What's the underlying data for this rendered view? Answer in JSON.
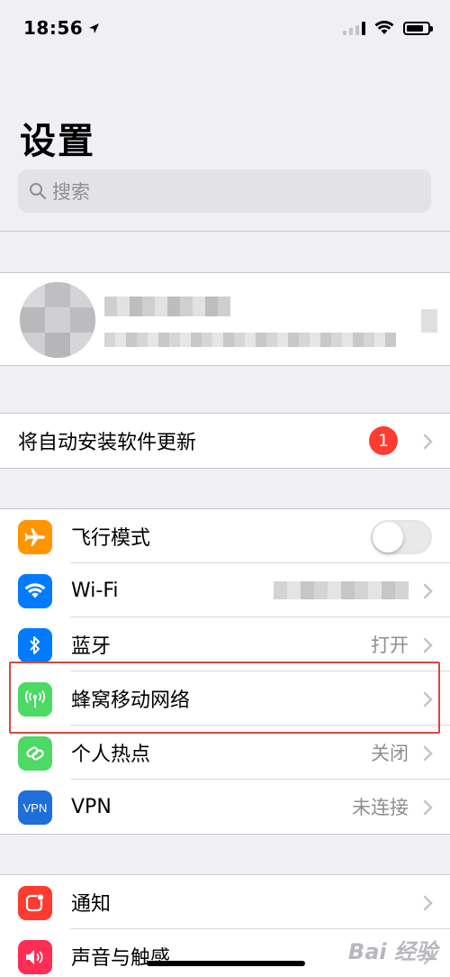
{
  "status_bar": {
    "time": "18:56"
  },
  "header": {
    "title": "设置"
  },
  "search": {
    "placeholder": "搜索"
  },
  "software_update": {
    "label": "将自动安装软件更新",
    "badge": "1"
  },
  "connectivity": {
    "airplane": {
      "label": "飞行模式",
      "icon": "airplane-icon",
      "color": "#ff9500",
      "toggle_on": false
    },
    "wifi": {
      "label": "Wi-Fi",
      "icon": "wifi-icon",
      "color": "#007aff"
    },
    "bluetooth": {
      "label": "蓝牙",
      "value": "打开",
      "icon": "bluetooth-icon",
      "color": "#007aff"
    },
    "cellular": {
      "label": "蜂窝移动网络",
      "icon": "cellular-antenna-icon",
      "color": "#4cd964"
    },
    "hotspot": {
      "label": "个人热点",
      "value": "关闭",
      "icon": "hotspot-icon",
      "color": "#4cd964"
    },
    "vpn": {
      "label": "VPN",
      "value": "未连接",
      "icon_text": "VPN",
      "color": "#1e6fd9"
    }
  },
  "notifications_group": {
    "notifications": {
      "label": "通知",
      "icon": "notifications-icon",
      "color": "#fe3b30"
    },
    "sounds": {
      "label": "声音与触感",
      "icon": "speaker-icon",
      "color": "#fe2d55"
    }
  },
  "watermark": {
    "text": "Bai 经验"
  }
}
